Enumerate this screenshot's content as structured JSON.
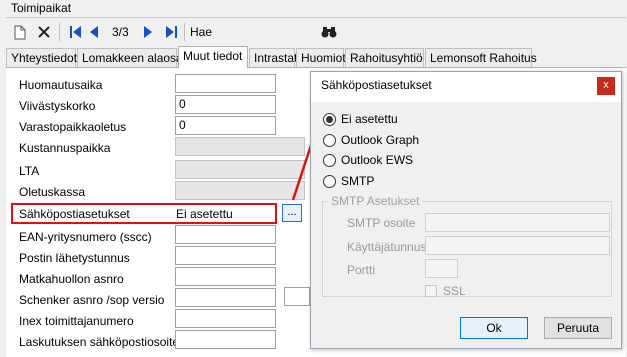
{
  "group": {
    "title": "Toimipaikat"
  },
  "toolbar": {
    "new_icon": "new-document-icon",
    "delete_icon": "delete-x-icon",
    "first_icon": "first-record-icon",
    "prev_icon": "previous-record-icon",
    "record_counter": "3/3",
    "next_icon": "next-record-icon",
    "last_icon": "last-record-icon",
    "search_label": "Hae",
    "binoculars_icon": "binoculars-icon"
  },
  "tabs": [
    {
      "label": "Yhteystiedot"
    },
    {
      "label": "Lomakkeen alaosa"
    },
    {
      "label": "Muut tiedot"
    },
    {
      "label": "Intrastat"
    },
    {
      "label": "Huomiot"
    },
    {
      "label": "Rahoitusyhtiö"
    },
    {
      "label": "Lemonsoft Rahoitus"
    }
  ],
  "form": {
    "huomautusaika": {
      "label": "Huomautusaika",
      "value": ""
    },
    "viivastyskorko": {
      "label": "Viivästyskorko",
      "value": "0"
    },
    "varastopaikkaoletus": {
      "label": "Varastopaikkaoletus",
      "value": "0"
    },
    "kustannuspaikka": {
      "label": "Kustannuspaikka",
      "value": ""
    },
    "lta": {
      "label": "LTA",
      "value": ""
    },
    "oletuskassa": {
      "label": "Oletuskassa",
      "value": ""
    },
    "sahkopostiasetukset": {
      "label": "Sähköpostiasetukset",
      "value": "Ei asetettu",
      "button": "..."
    },
    "ean": {
      "label": "EAN-yritysnumero (sscc)",
      "value": ""
    },
    "postin": {
      "label": "Postin lähetystunnus",
      "value": ""
    },
    "matkahuolto": {
      "label": "Matkahuollon asnro",
      "value": ""
    },
    "schenker": {
      "label": "Schenker asnro /sop versio",
      "value": ""
    },
    "inex": {
      "label": "Inex toimittajanumero",
      "value": ""
    },
    "laskutus": {
      "label": "Laskutuksen sähköpostiosoite",
      "value": ""
    }
  },
  "dialog": {
    "title": "Sähköpostiasetukset",
    "close": "x",
    "options": [
      {
        "label": "Ei asetettu",
        "selected": true
      },
      {
        "label": "Outlook Graph",
        "selected": false
      },
      {
        "label": "Outlook EWS",
        "selected": false
      },
      {
        "label": "SMTP",
        "selected": false
      }
    ],
    "smtp_group": "SMTP Asetukset",
    "smtp_address": "SMTP osoite",
    "username": "Käyttäjätunnus",
    "port": "Portti",
    "ssl": "SSL",
    "ok": "Ok",
    "cancel": "Peruuta"
  },
  "colors": {
    "highlight": "#e01010",
    "accent": "#0078d7",
    "close": "#c42b1c"
  }
}
